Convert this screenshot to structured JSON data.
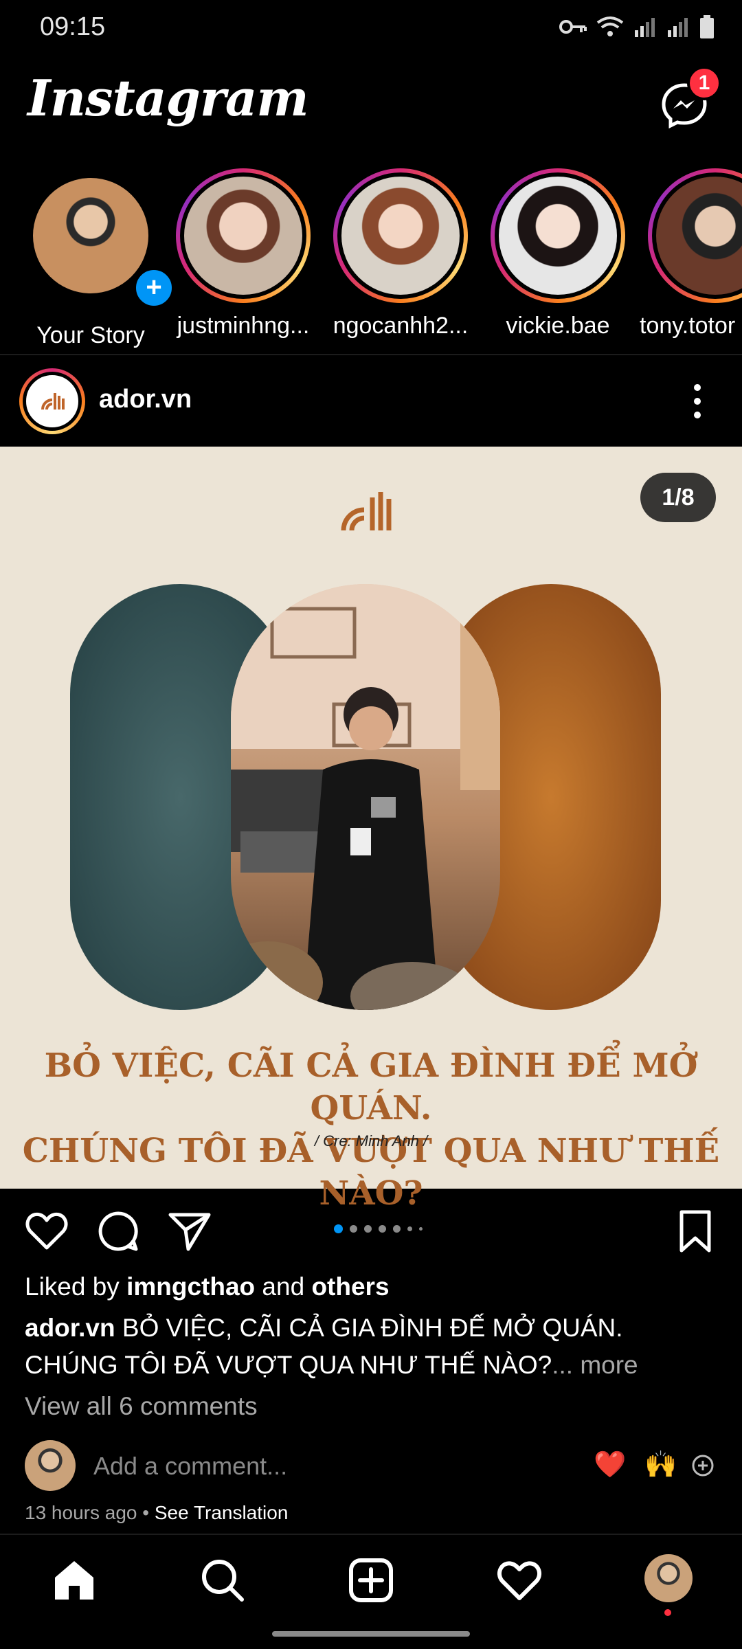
{
  "status_bar": {
    "time": "09:15"
  },
  "header": {
    "logo": "Instagram",
    "messenger_badge": "1"
  },
  "stories": [
    {
      "name": "Your Story",
      "own": true
    },
    {
      "name": "justminhng..."
    },
    {
      "name": "ngocanhh2..."
    },
    {
      "name": "vickie.bae"
    },
    {
      "name": "tony.totor"
    }
  ],
  "post": {
    "username": "ador.vn",
    "counter": "1/8",
    "headline_line1": "BỎ VIỆC, CÃI CẢ GIA ĐÌNH ĐỂ MỞ QUÁN.",
    "headline_line2": "CHÚNG TÔI ĐÃ VƯỢT QUA NHƯ THẾ NÀO?",
    "credit": "/ Cre: Minh Anh /",
    "liked_prefix": "Liked by ",
    "liked_user": "imngcthao",
    "liked_mid": " and ",
    "liked_others": "others",
    "caption_user": "ador.vn",
    "caption_text": " BỎ VIỆC, CÃI CẢ GIA ĐÌNH ĐẾ MỞ QUÁN. CHÚNG TÔI ĐÃ VƯỢT QUA NHƯ THẾ NÀO?",
    "caption_more": "... more",
    "view_comments": "View all 6 comments",
    "comment_placeholder": "Add a comment...",
    "reactions": [
      "❤️",
      "🙌"
    ],
    "time_ago": "13 hours ago",
    "see_translation": "See Translation"
  },
  "colors": {
    "accent": "#0095f6",
    "badge": "#ff3040",
    "headline": "#a8602a"
  }
}
